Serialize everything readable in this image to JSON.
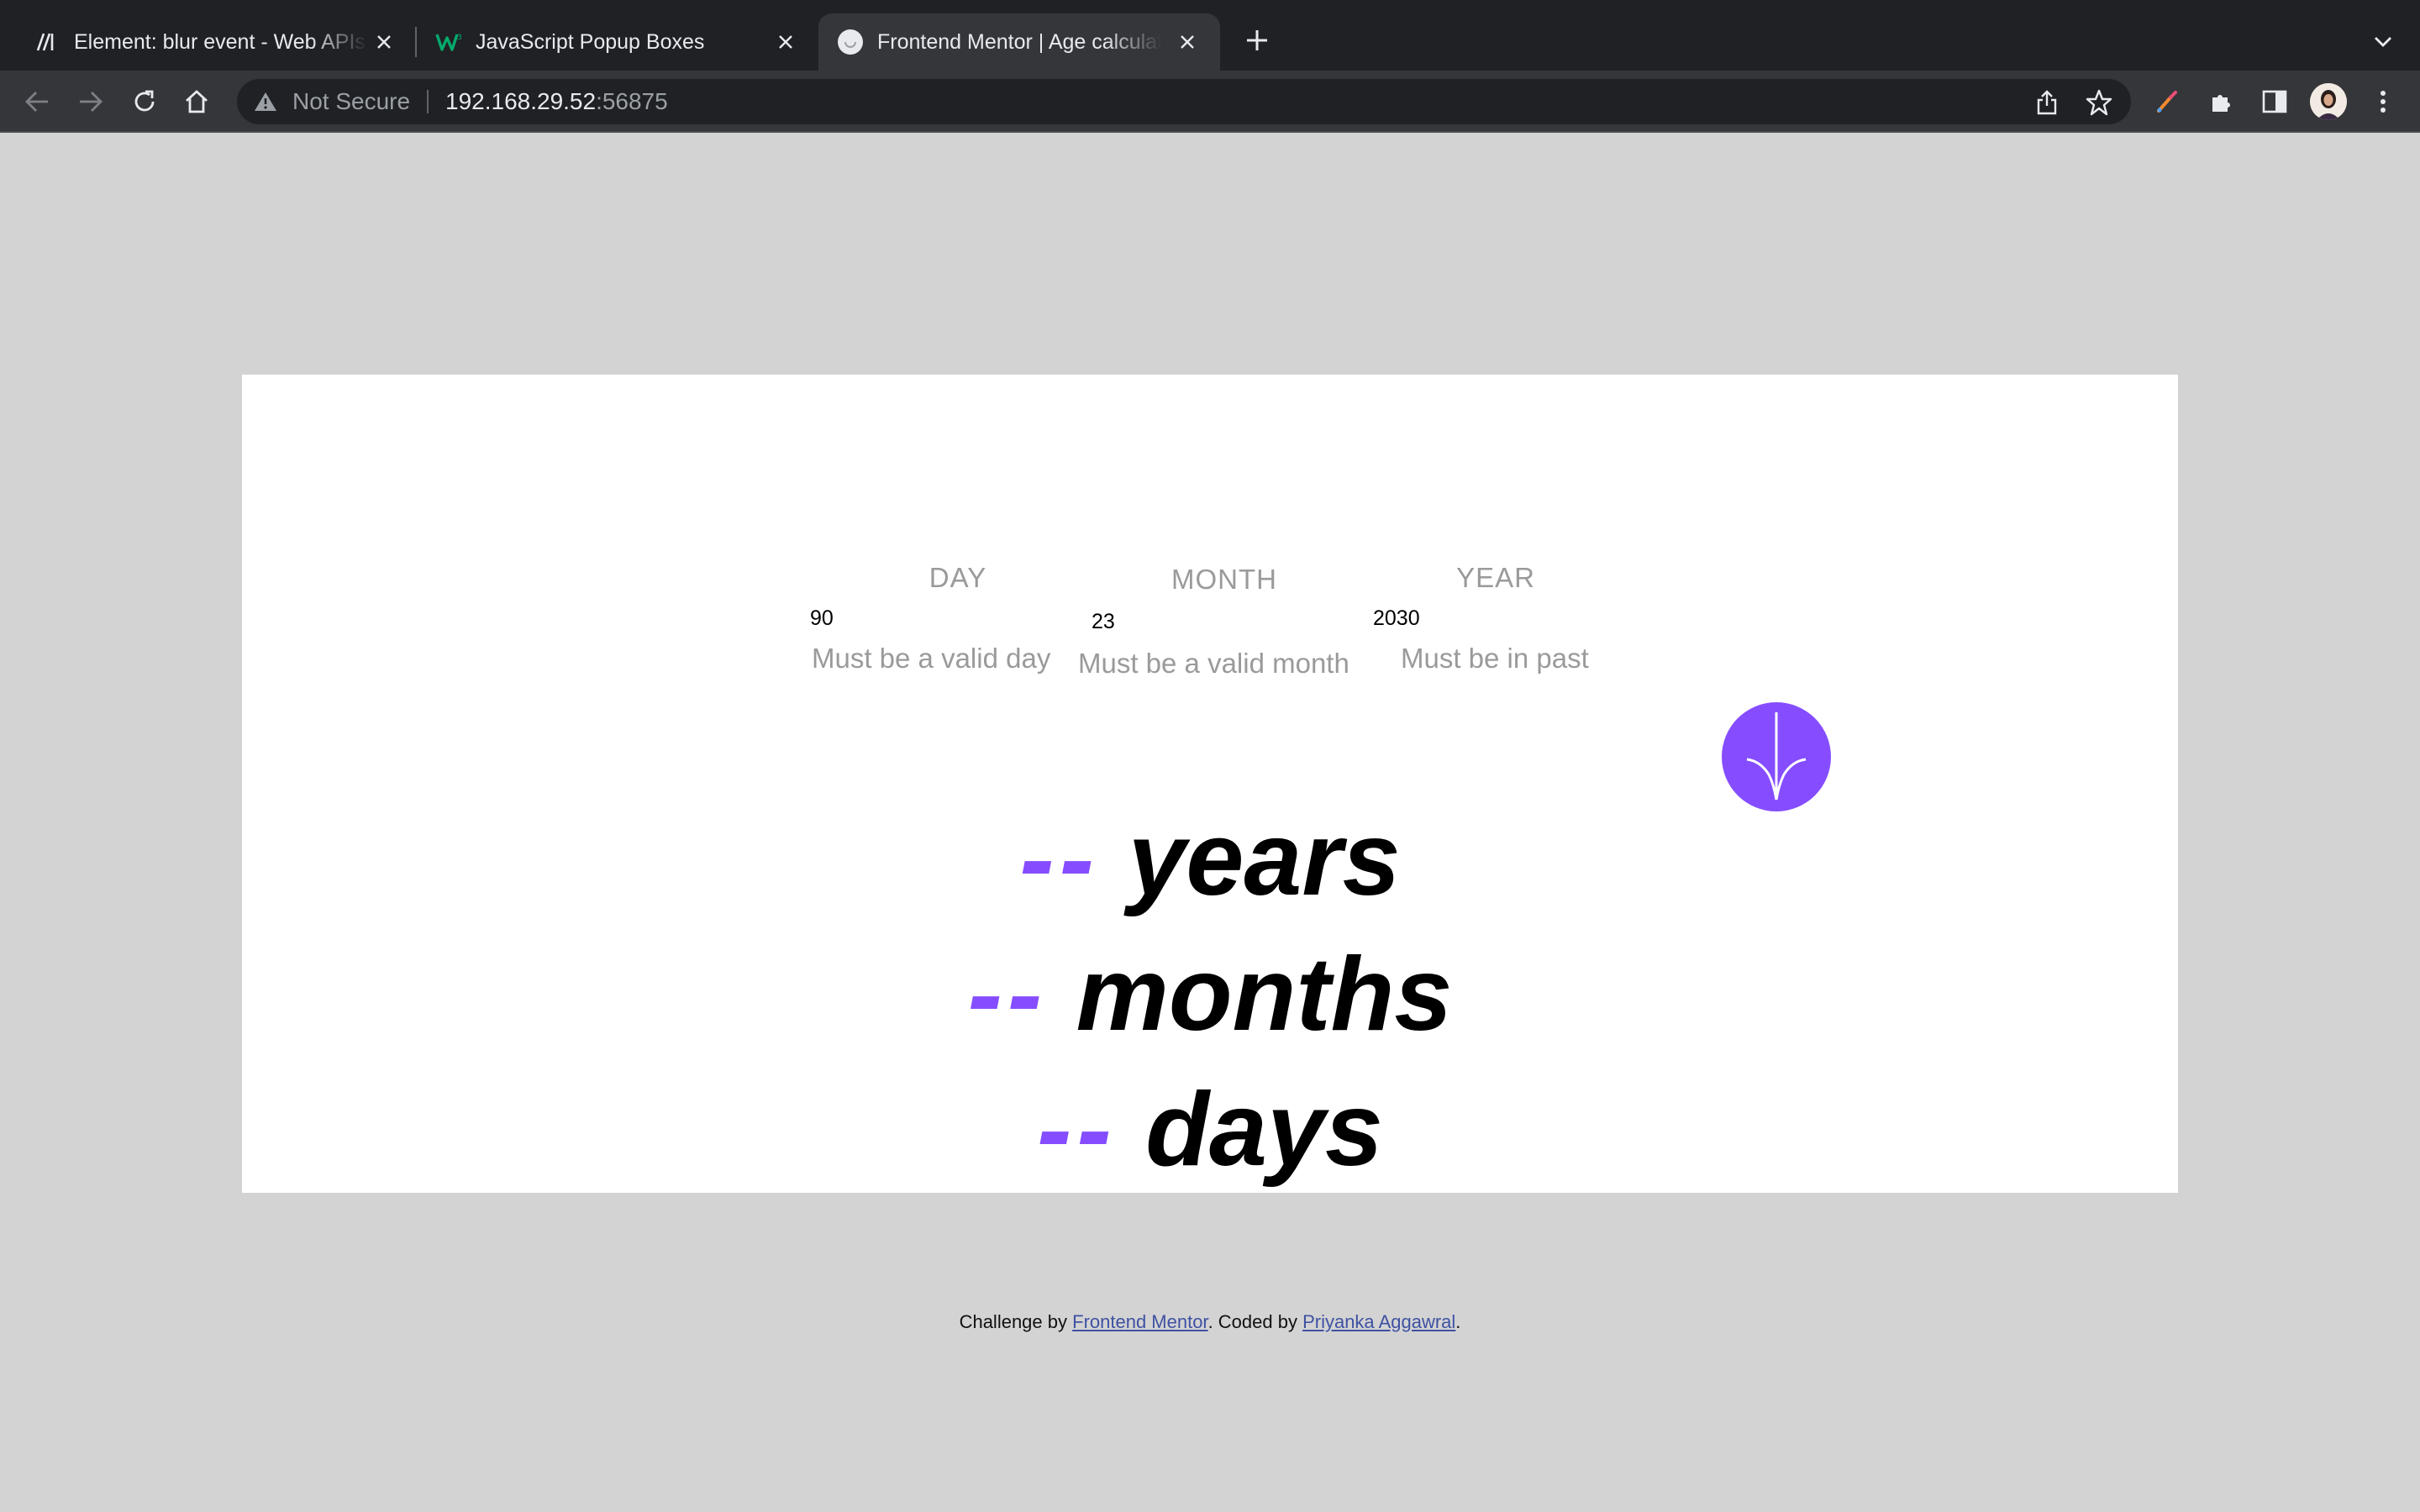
{
  "browser": {
    "tabs": [
      {
        "title": "Element: blur event - Web APIs",
        "favicon": "mdn-icon",
        "active": false
      },
      {
        "title": "JavaScript Popup Boxes",
        "favicon": "w3schools-icon",
        "active": false
      },
      {
        "title": "Frontend Mentor | Age calculator",
        "favicon": "frontend-mentor-icon",
        "active": true
      }
    ],
    "address_bar": {
      "security_label": "Not Secure",
      "host": "192.168.29.52",
      "port": ":56875"
    }
  },
  "form": {
    "day": {
      "label": "DAY",
      "value": "90",
      "error": "Must be a valid day"
    },
    "month": {
      "label": "MONTH",
      "value": "23",
      "error": "Must be a valid month"
    },
    "year": {
      "label": "YEAR",
      "value": "2030",
      "error": "Must be in past"
    }
  },
  "submit": {
    "icon": "arrow-down-icon",
    "color": "#854dff"
  },
  "results": {
    "years": {
      "value": "--",
      "unit": "years"
    },
    "months": {
      "value": "--",
      "unit": "months"
    },
    "days": {
      "value": "--",
      "unit": "days"
    }
  },
  "attribution": {
    "prefix": "Challenge by ",
    "link1": "Frontend Mentor",
    "middle": ". Coded by ",
    "link2": "Priyanka Aggawral",
    "suffix": "."
  },
  "colors": {
    "accent": "#854dff",
    "page_bg": "#d3d3d3",
    "card_bg": "#ffffff",
    "muted_text": "#9a9a9a"
  }
}
